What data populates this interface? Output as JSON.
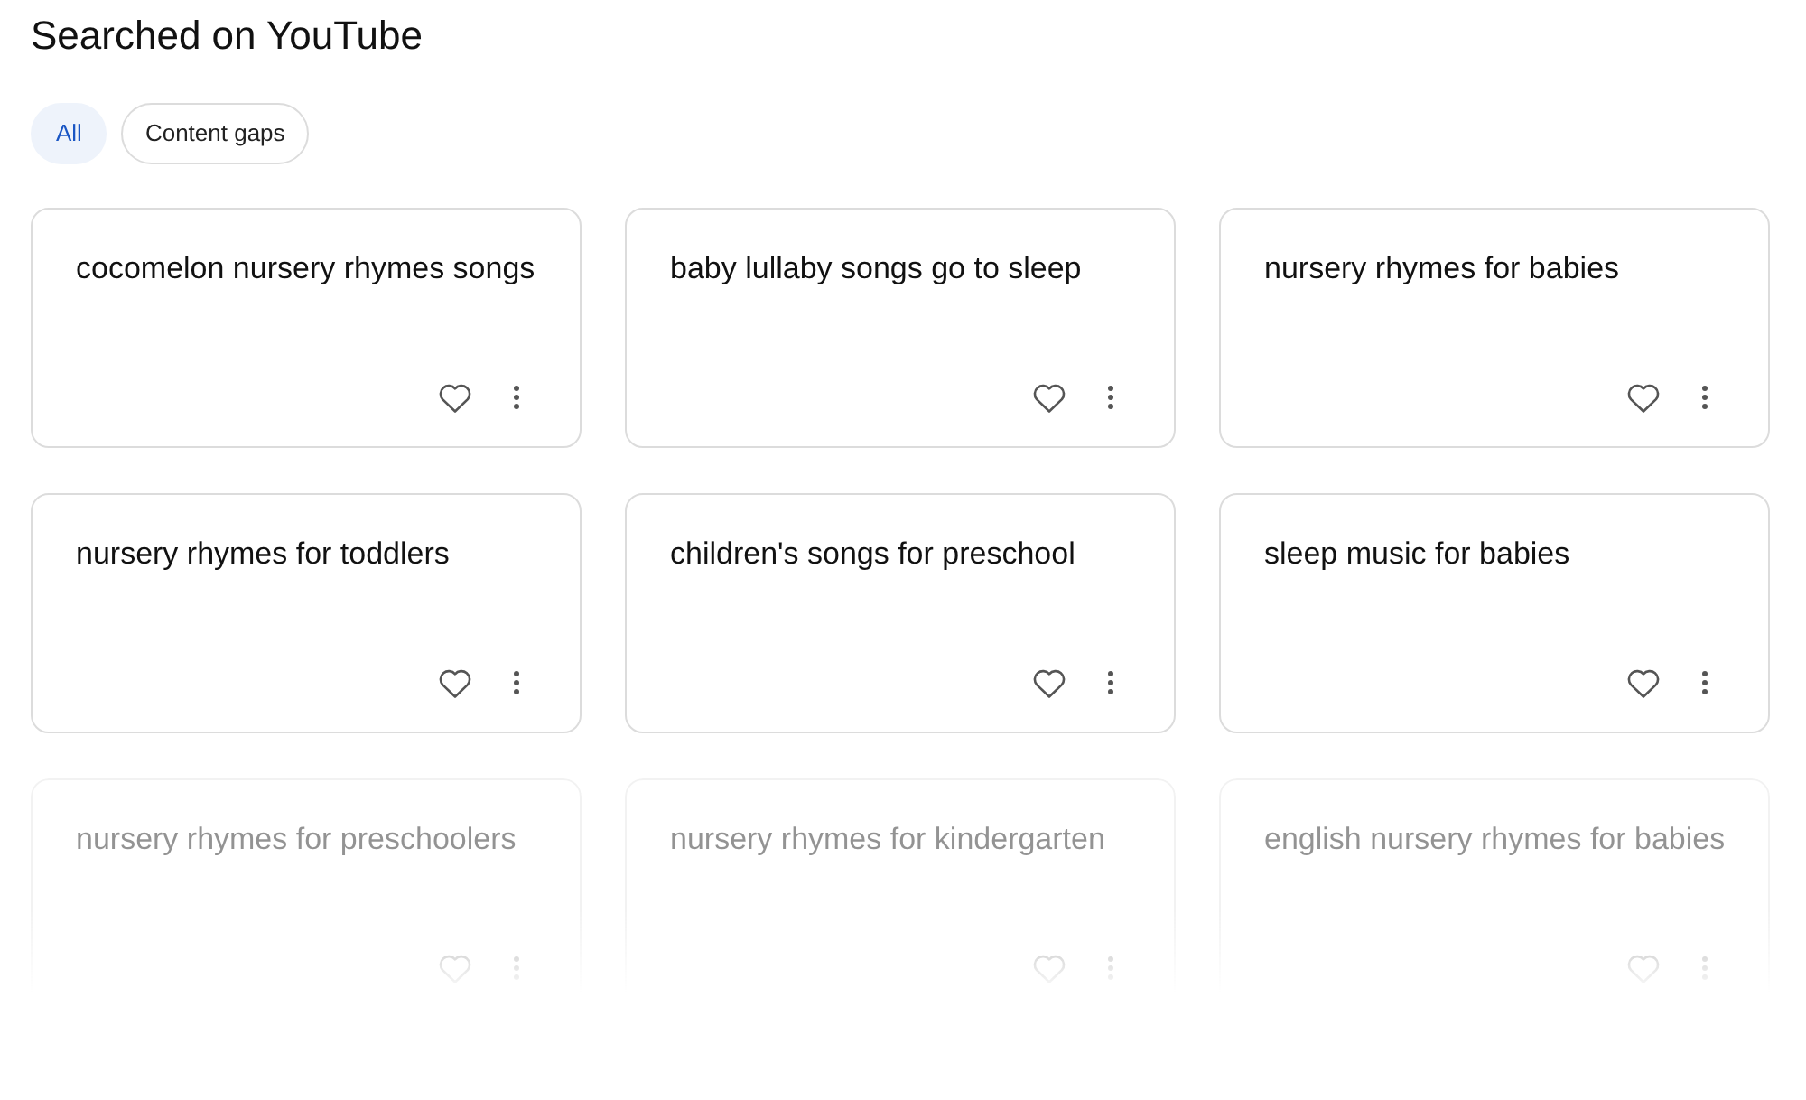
{
  "title": "Searched on YouTube",
  "filters": [
    {
      "label": "All",
      "selected": true
    },
    {
      "label": "Content gaps",
      "selected": false
    }
  ],
  "cards": [
    {
      "query": "cocomelon nursery rhymes songs",
      "faded": false
    },
    {
      "query": "baby lullaby songs go to sleep",
      "faded": false
    },
    {
      "query": "nursery rhymes for babies",
      "faded": false
    },
    {
      "query": "nursery rhymes for toddlers",
      "faded": false
    },
    {
      "query": "children's songs for preschool",
      "faded": false
    },
    {
      "query": "sleep music for babies",
      "faded": false
    },
    {
      "query": "nursery rhymes for preschoolers",
      "faded": true
    },
    {
      "query": "nursery rhymes for kindergarten",
      "faded": true
    },
    {
      "query": "english nursery rhymes for babies",
      "faded": true
    }
  ]
}
